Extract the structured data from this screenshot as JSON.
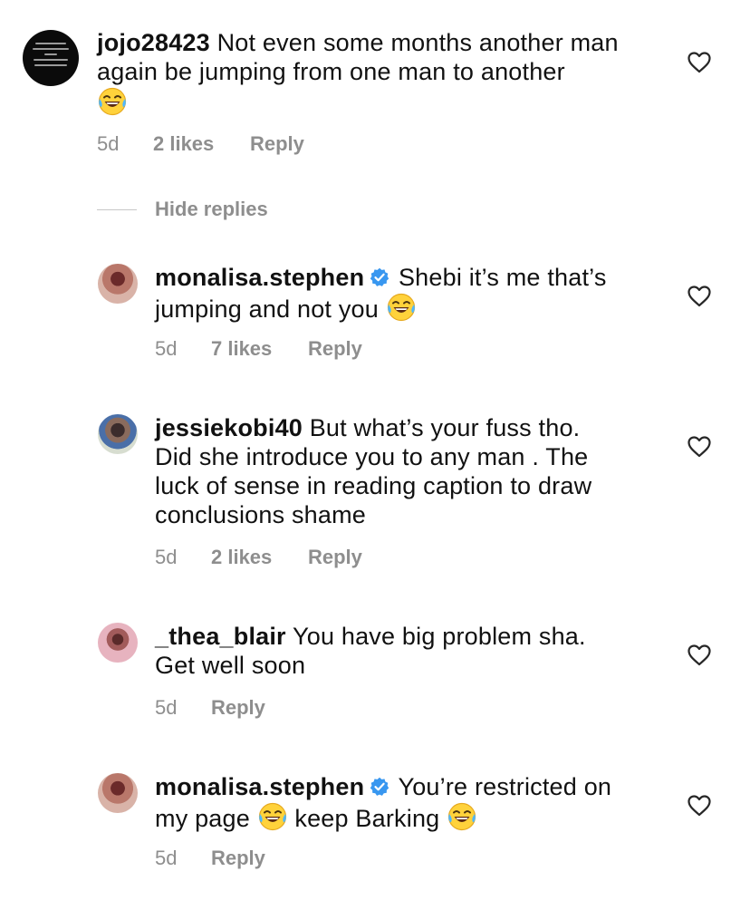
{
  "comments": [
    {
      "username": "jojo28423",
      "text": "Not even some months another man again be jumping from one man to another",
      "time": "5d",
      "likes": "2 likes",
      "reply": "Reply",
      "emoji": "face-with-tears-of-joy",
      "avatar_text": "Sorry I have a woman in my life already and I can't cheat on her. Ladies have you ever heard of such from any man??"
    }
  ],
  "hide_replies": "Hide replies",
  "replies": [
    {
      "username": "monalisa.stephen",
      "verified": true,
      "text_before": "Shebi it’s me that’s jumping and not you",
      "time": "5d",
      "likes": "7 likes",
      "reply": "Reply"
    },
    {
      "username": "jessiekobi40",
      "verified": false,
      "text_line1": "But what’s your fuss tho.",
      "text_line2": "Did she introduce you to any man . The",
      "text_line3": "luck of sense in reading caption to draw",
      "text_line4": "conclusions shame",
      "time": "5d",
      "likes": "2 likes",
      "reply": "Reply"
    },
    {
      "username": "_thea_blair",
      "verified": false,
      "text_line1": "You have big problem sha.",
      "text_line2": "Get well soon",
      "time": "5d",
      "reply": "Reply"
    },
    {
      "username": "monalisa.stephen",
      "verified": true,
      "text_line1": "You’re restricted on",
      "text_line2a": "my page",
      "text_line2b": "keep Barking",
      "time": "5d",
      "reply": "Reply"
    }
  ],
  "colors": {
    "text": "#111111",
    "meta": "#8e8e8e",
    "verified_badge": "#3897f0",
    "divider": "#c7c7c7"
  },
  "icons": [
    "heart-icon",
    "verified-badge-icon",
    "face-with-tears-of-joy-emoji"
  ]
}
